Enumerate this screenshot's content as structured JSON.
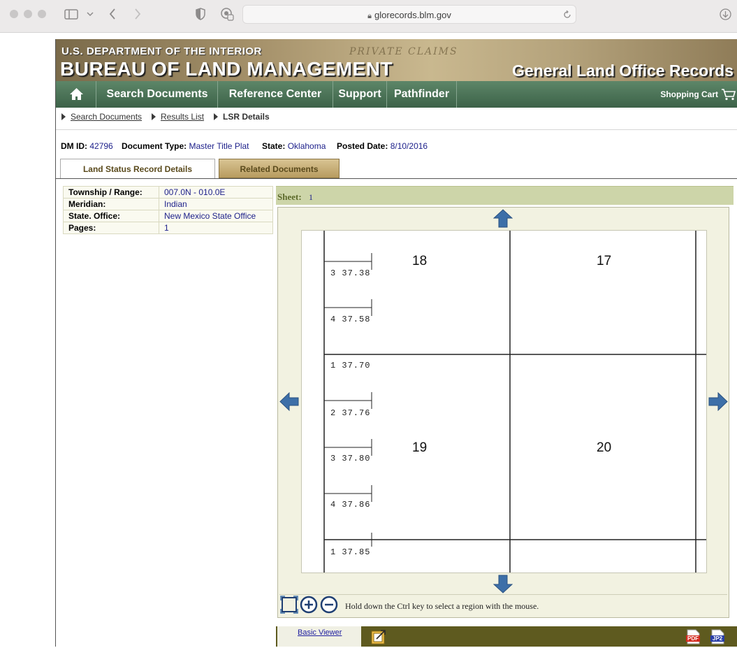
{
  "browser": {
    "url": "glorecords.blm.gov"
  },
  "banner": {
    "department": "U.S. DEPARTMENT OF THE INTERIOR",
    "bureau": "BUREAU OF LAND MANAGEMENT",
    "records": "General Land Office Records",
    "background_script": "PRIVATE CLAIMS"
  },
  "nav": {
    "items": [
      "Search Documents",
      "Reference Center",
      "Support",
      "Pathfinder"
    ],
    "cart": "Shopping Cart"
  },
  "breadcrumb": {
    "search": "Search Documents",
    "results": "Results List",
    "current": "LSR Details"
  },
  "meta": {
    "dm_id_label": "DM ID:",
    "dm_id": "42796",
    "doc_type_label": "Document Type:",
    "doc_type": "Master Title Plat",
    "state_label": "State:",
    "state": "Oklahoma",
    "posted_label": "Posted Date:",
    "posted": "8/10/2016"
  },
  "tabs": {
    "active": "Land Status Record Details",
    "inactive": "Related Documents"
  },
  "details": [
    {
      "key": "Township / Range:",
      "value": "007.0N - 010.0E"
    },
    {
      "key": "Meridian:",
      "value": "Indian"
    },
    {
      "key": "State. Office:",
      "value": "New Mexico State Office"
    },
    {
      "key": "Pages:",
      "value": "1"
    }
  ],
  "viewer": {
    "sheet_label": "Sheet:",
    "sheet_num": "1",
    "hint": "Hold down the Ctrl key to select a region with the mouse.",
    "plat_sections": [
      "18",
      "17",
      "19",
      "20"
    ],
    "plat_lots": [
      "3  37.38",
      "4  37.58",
      "1  37.70",
      "2  37.76",
      "3  37.80",
      "4  37.86",
      "1  37.85"
    ]
  },
  "footer": {
    "basic_viewer": "Basic Viewer",
    "pdf": "PDF",
    "jp2": "JP2"
  },
  "colors": {
    "nav_green": "#3c6248",
    "link_blue": "#1c1f8a",
    "arrow_blue": "#3d6fa8",
    "footer_olive": "#5e5a1f"
  }
}
